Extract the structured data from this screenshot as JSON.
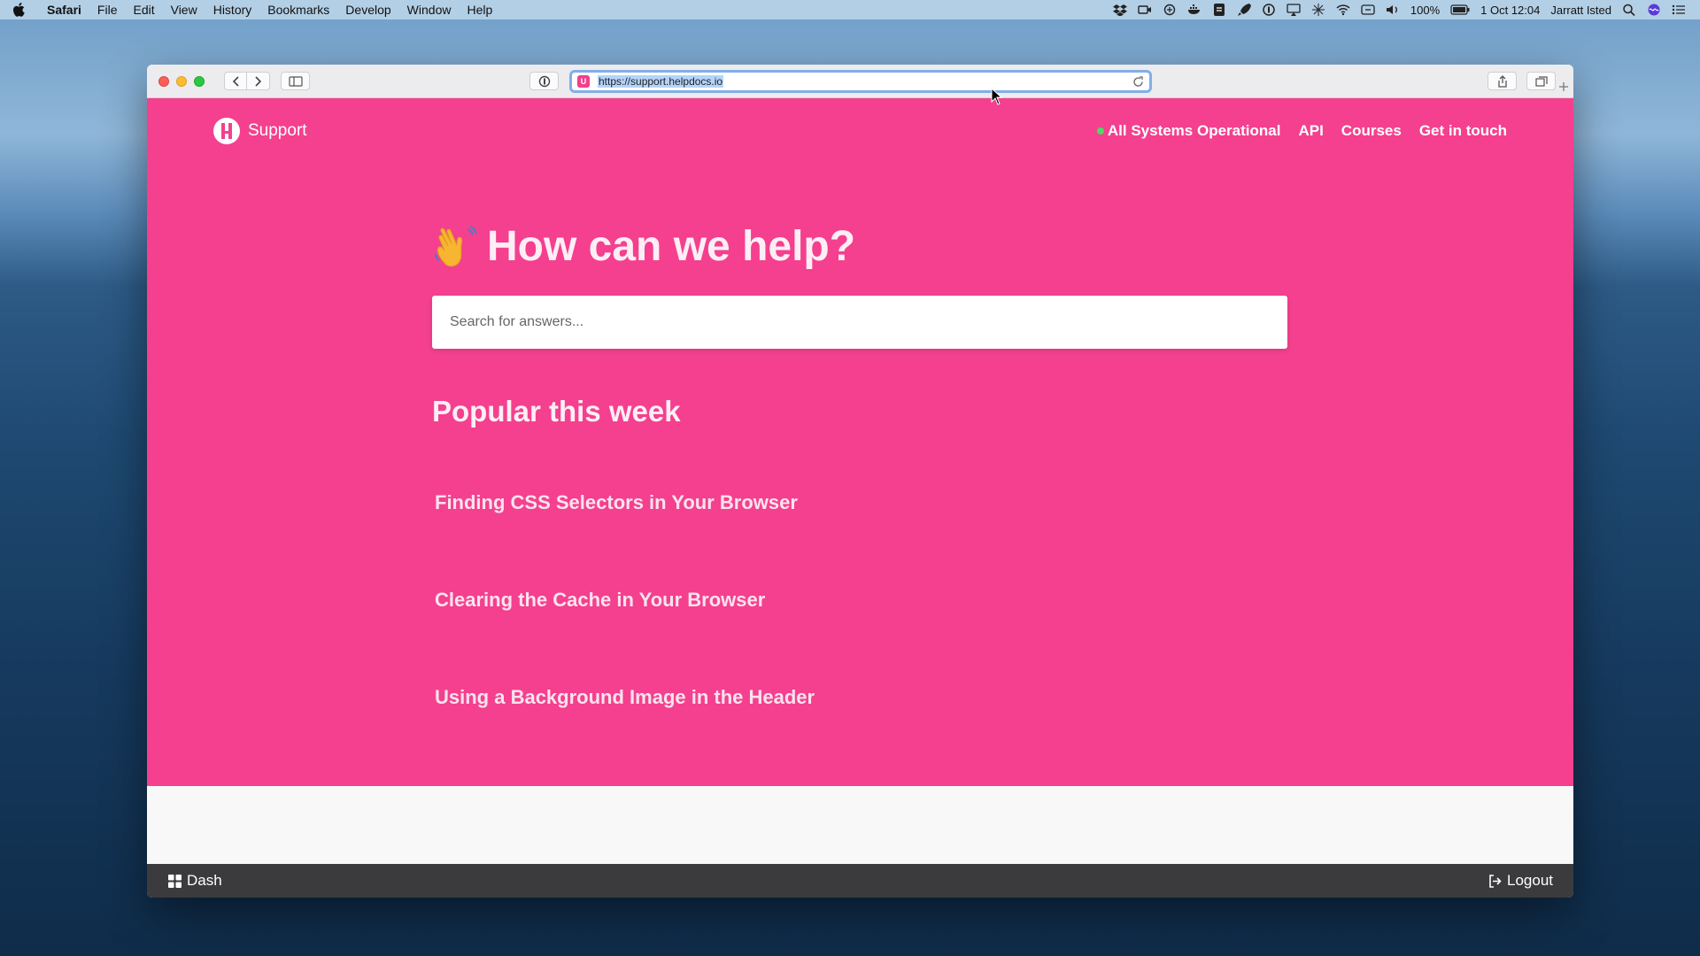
{
  "menubar": {
    "app": "Safari",
    "items": [
      "File",
      "Edit",
      "View",
      "History",
      "Bookmarks",
      "Develop",
      "Window",
      "Help"
    ],
    "battery": "100%",
    "datetime": "1 Oct  12:04",
    "user": "Jarratt Isted"
  },
  "browser": {
    "url": "https://support.helpdocs.io",
    "accent": "#82aee8"
  },
  "site": {
    "brand": "Support",
    "nav": {
      "status": "All Systems Operational",
      "api": "API",
      "courses": "Courses",
      "contact": "Get in touch"
    },
    "hero_title": "How can we help?",
    "search_placeholder": "Search for answers...",
    "popular_title": "Popular this week",
    "articles": [
      "Finding CSS Selectors in Your Browser",
      "Clearing the Cache in Your Browser",
      "Using a Background Image in the Header"
    ],
    "brand_color": "#f4408e"
  },
  "bottom_bar": {
    "dash": "Dash",
    "logout": "Logout"
  }
}
